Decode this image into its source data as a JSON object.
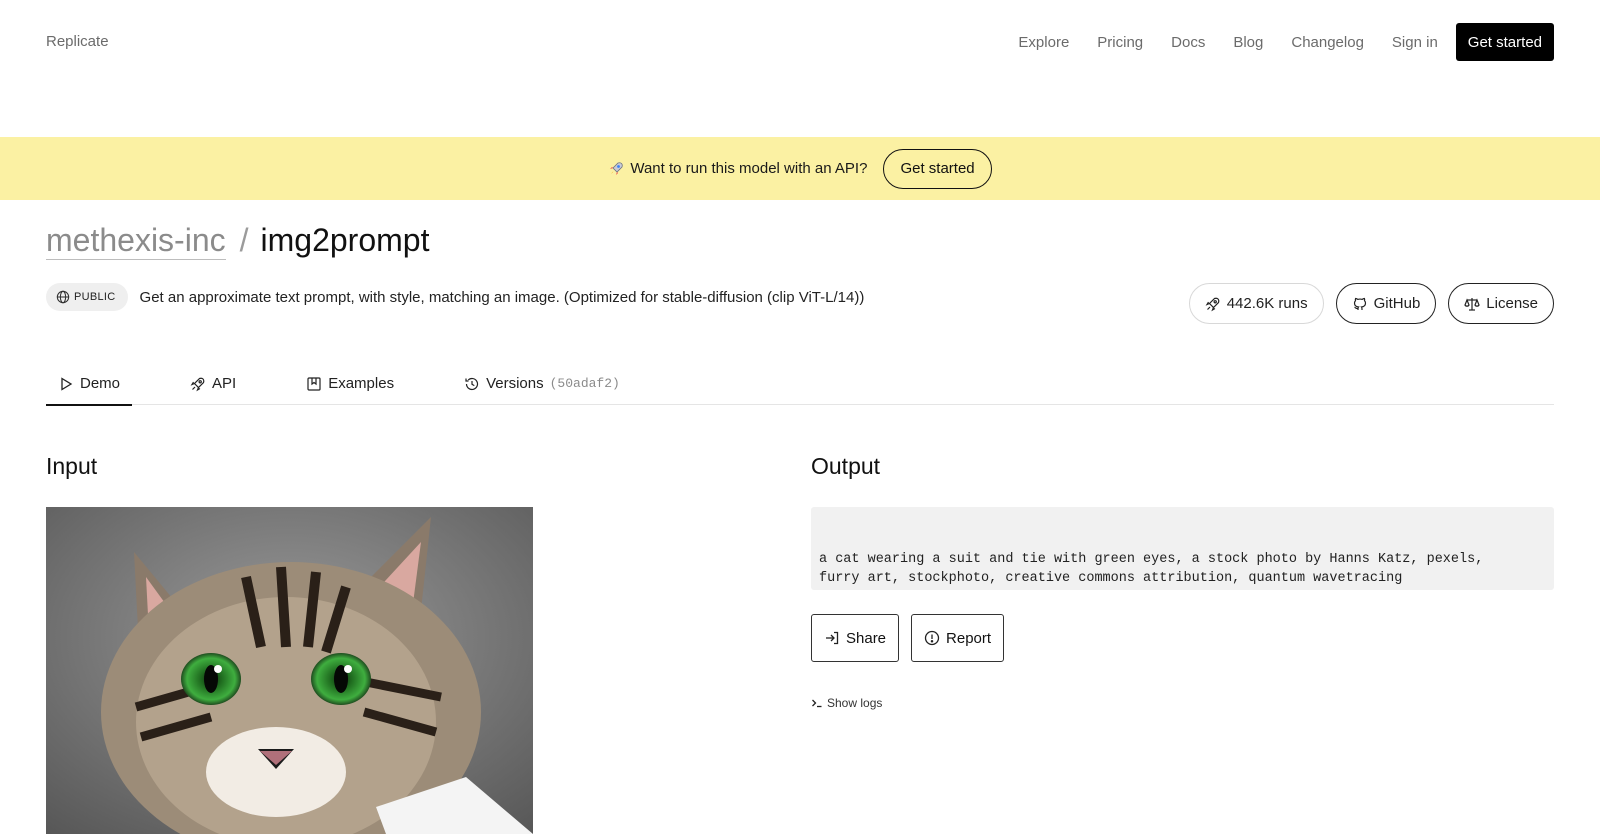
{
  "nav": {
    "brand": "Replicate",
    "links": [
      "Explore",
      "Pricing",
      "Docs",
      "Blog",
      "Changelog",
      "Sign in"
    ],
    "cta": "Get started"
  },
  "banner": {
    "text": "Want to run this model with an API?",
    "button": "Get started"
  },
  "model": {
    "owner": "methexis-inc",
    "separator": "/",
    "name": "img2prompt",
    "visibility": "PUBLIC",
    "description": "Get an approximate text prompt, with style, matching an image. (Optimized for stable-diffusion (clip ViT-L/14))"
  },
  "stats": {
    "runs": "442.6K runs",
    "github": "GitHub",
    "license": "License"
  },
  "tabs": [
    {
      "label": "Demo",
      "icon": "play-icon"
    },
    {
      "label": "API",
      "icon": "rocket-icon"
    },
    {
      "label": "Examples",
      "icon": "bookmark-icon"
    },
    {
      "label": "Versions",
      "icon": "history-icon",
      "hash": "(50adaf2)"
    }
  ],
  "input": {
    "title": "Input"
  },
  "output": {
    "title": "Output",
    "text": "a cat wearing a suit and tie with green eyes, a stock photo by Hanns Katz, pexels,\nfurry art, stockphoto, creative commons attribution, quantum wavetracing",
    "share": "Share",
    "report": "Report",
    "show_logs": "Show logs"
  },
  "colors": {
    "banner": "#fbf1a3",
    "cta": "#000000",
    "output_bg": "#f1f1f1"
  }
}
